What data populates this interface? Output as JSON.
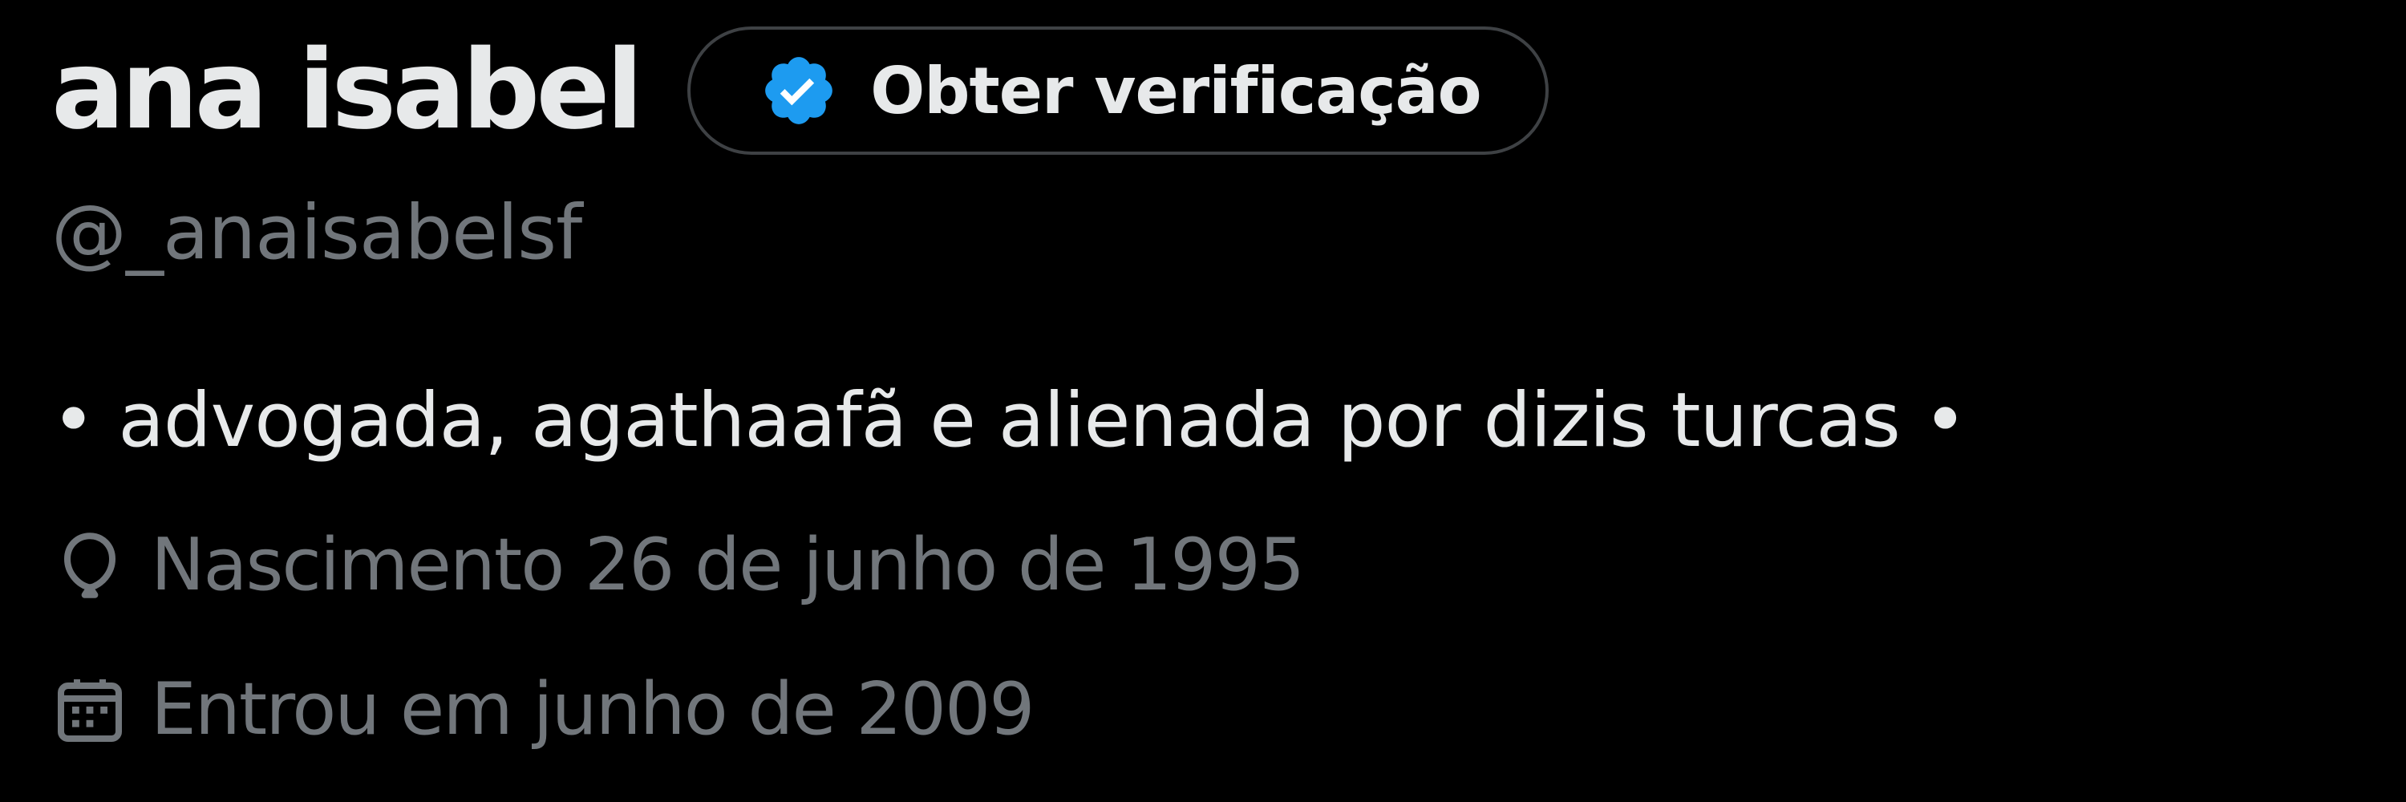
{
  "profile": {
    "display_name": "ana isabel",
    "handle": "@_anaisabelsf",
    "bio": "• advogada, agathaafã e alienada por dizis turcas •",
    "verify_button": {
      "label": "Obter verificação",
      "icon": "verified-badge-icon"
    },
    "birth": {
      "icon": "balloon-icon",
      "text": "Nascimento 26 de junho de 1995"
    },
    "joined": {
      "icon": "calendar-icon",
      "text": "Entrou em junho de 2009"
    }
  },
  "colors": {
    "background": "#000000",
    "primary_text": "#e7e9ea",
    "secondary_text": "#71767b",
    "verified_blue": "#1d9bf0",
    "button_border": "#3e4144"
  }
}
